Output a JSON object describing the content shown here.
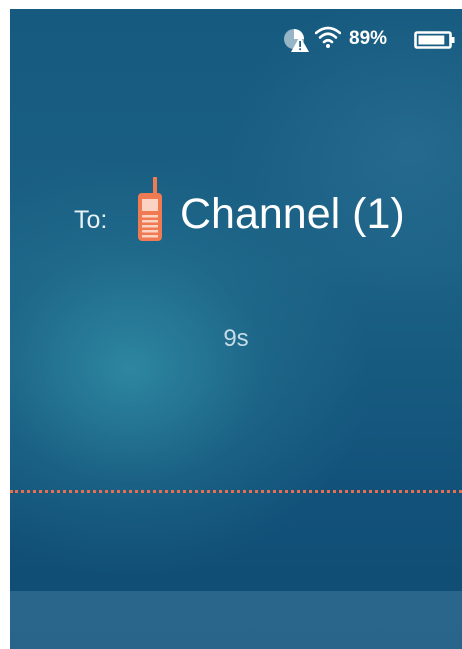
{
  "status_bar": {
    "battery_percent": "89%",
    "battery_level": 0.89,
    "icons": [
      "no-sim-warning-icon",
      "wifi-icon",
      "battery-icon"
    ]
  },
  "call": {
    "to_label": "To:",
    "channel_name": "Channel (1)",
    "target_icon": "walkie-talkie-icon",
    "elapsed": "9s"
  },
  "colors": {
    "accent": "#f07a52",
    "background_top": "#165a7f",
    "background_bottom": "#0f4b72",
    "divider": "#e86f4e"
  }
}
